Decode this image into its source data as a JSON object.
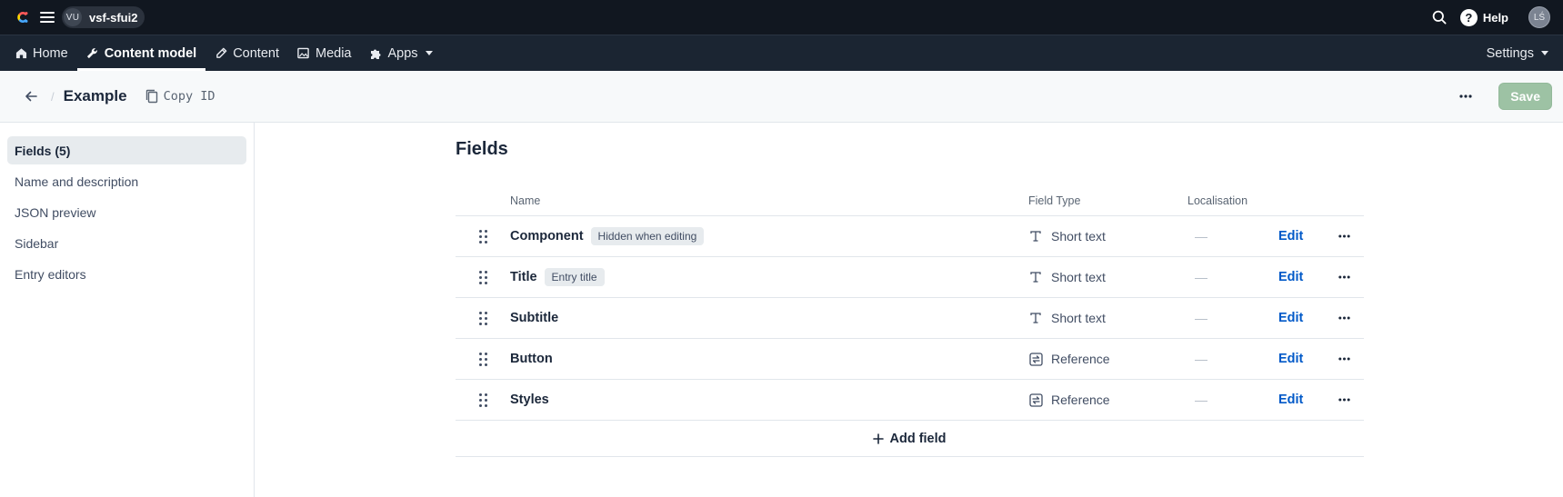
{
  "topbar": {
    "space_initials": "VU",
    "space_name": "vsf-sfui2",
    "help_label": "Help",
    "user_initials": "LŚ"
  },
  "nav": {
    "items": [
      {
        "label": "Home",
        "icon": "home-icon"
      },
      {
        "label": "Content model",
        "icon": "wrench-icon",
        "active": true
      },
      {
        "label": "Content",
        "icon": "pen-icon"
      },
      {
        "label": "Media",
        "icon": "image-icon"
      },
      {
        "label": "Apps",
        "icon": "puzzle-icon"
      }
    ],
    "settings_label": "Settings"
  },
  "header": {
    "title": "Example",
    "copy_id_label": "Copy ID",
    "save_label": "Save"
  },
  "sidebar": {
    "items": [
      {
        "label": "Fields (5)",
        "active": true
      },
      {
        "label": "Name and description"
      },
      {
        "label": "JSON preview"
      },
      {
        "label": "Sidebar"
      },
      {
        "label": "Entry editors"
      }
    ]
  },
  "fields": {
    "section_title": "Fields",
    "columns": {
      "name": "Name",
      "type": "Field Type",
      "localisation": "Localisation"
    },
    "rows": [
      {
        "name": "Component",
        "badge": "Hidden when editing",
        "type": "Short text",
        "type_icon": "text-type-icon",
        "localisation": "—",
        "edit": "Edit"
      },
      {
        "name": "Title",
        "badge": "Entry title",
        "type": "Short text",
        "type_icon": "text-type-icon",
        "localisation": "—",
        "edit": "Edit"
      },
      {
        "name": "Subtitle",
        "badge": "",
        "type": "Short text",
        "type_icon": "text-type-icon",
        "localisation": "—",
        "edit": "Edit"
      },
      {
        "name": "Button",
        "badge": "",
        "type": "Reference",
        "type_icon": "reference-icon",
        "localisation": "—",
        "edit": "Edit"
      },
      {
        "name": "Styles",
        "badge": "",
        "type": "Reference",
        "type_icon": "reference-icon",
        "localisation": "—",
        "edit": "Edit"
      }
    ],
    "add_label": "Add field"
  }
}
